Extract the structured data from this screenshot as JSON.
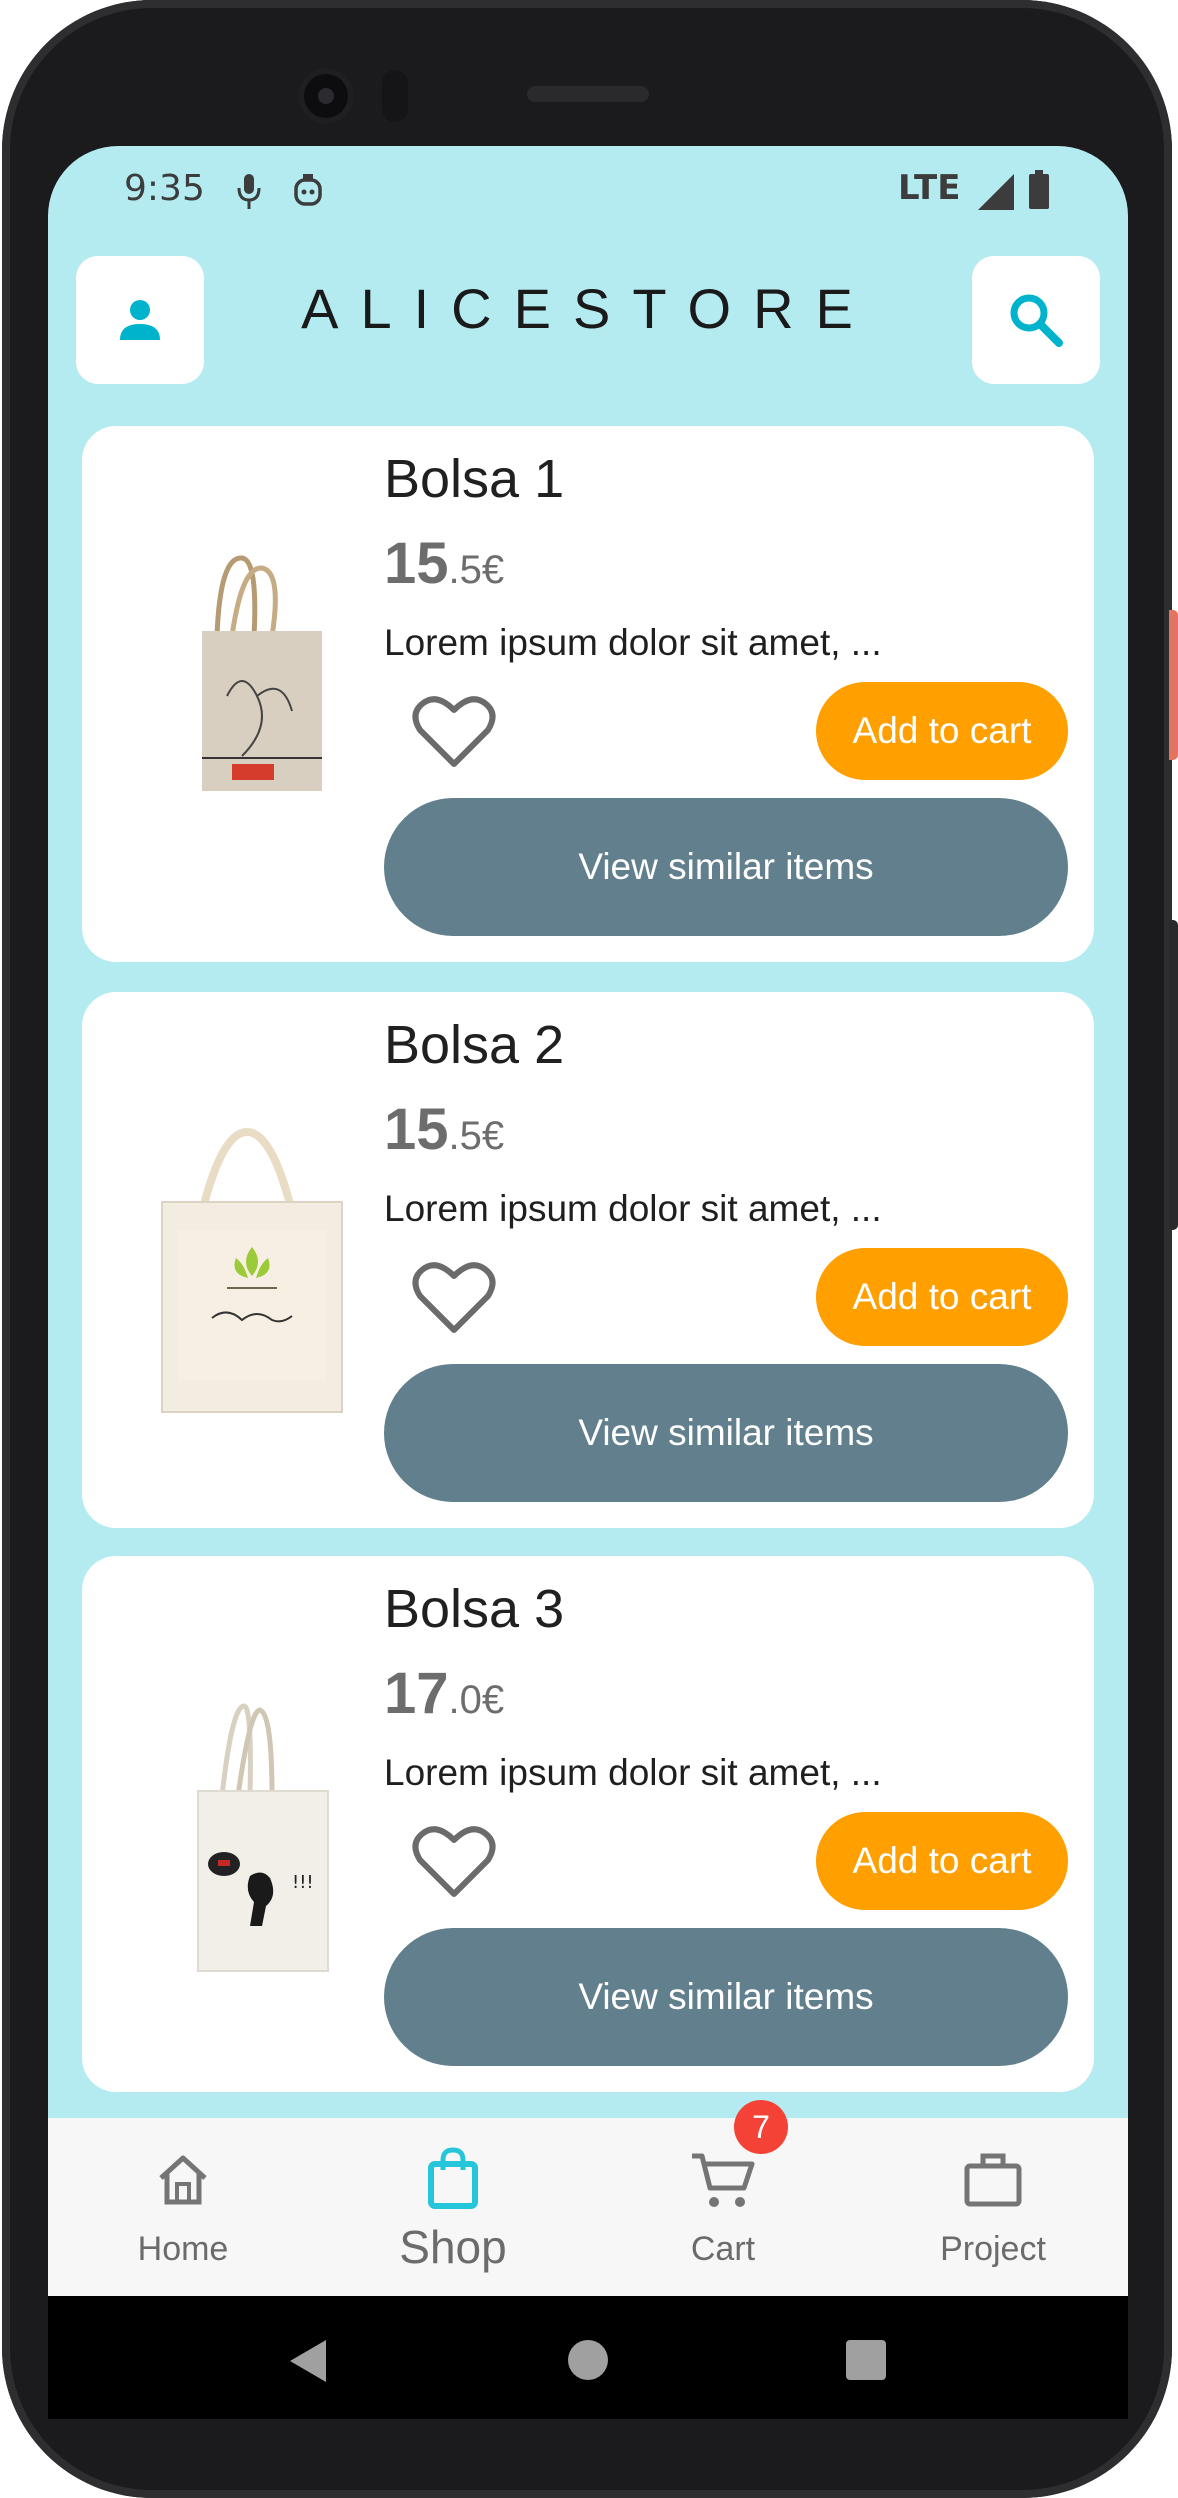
{
  "status_bar": {
    "time": "9:35",
    "network": "LTE"
  },
  "header": {
    "brand": "ALICESTORE",
    "profile_icon": "person-icon",
    "search_icon": "search-icon"
  },
  "products": [
    {
      "title": "Bolsa 1",
      "price_int": "15",
      "price_dec": ".5€",
      "description": "Lorem ipsum dolor sit amet, ...",
      "add_label": "Add to cart",
      "similar_label": "View similar items"
    },
    {
      "title": "Bolsa 2",
      "price_int": "15",
      "price_dec": ".5€",
      "description": "Lorem ipsum dolor sit amet, ...",
      "add_label": "Add to cart",
      "similar_label": "View similar items"
    },
    {
      "title": "Bolsa 3",
      "price_int": "17",
      "price_dec": ".0€",
      "description": "Lorem ipsum dolor sit amet, ...",
      "add_label": "Add to cart",
      "similar_label": "View similar items"
    }
  ],
  "bottom_nav": {
    "items": [
      {
        "label": "Home",
        "icon": "home-icon"
      },
      {
        "label": "Shop",
        "icon": "shopping-bag-icon",
        "active": true
      },
      {
        "label": "Cart",
        "icon": "cart-icon",
        "badge": "7"
      },
      {
        "label": "Project",
        "icon": "briefcase-icon"
      }
    ]
  },
  "colors": {
    "background": "#b3ebf0",
    "accent": "#00bcd4",
    "add_to_cart": "#ff9f00",
    "similar": "#617f8c",
    "badge": "#f44336"
  }
}
